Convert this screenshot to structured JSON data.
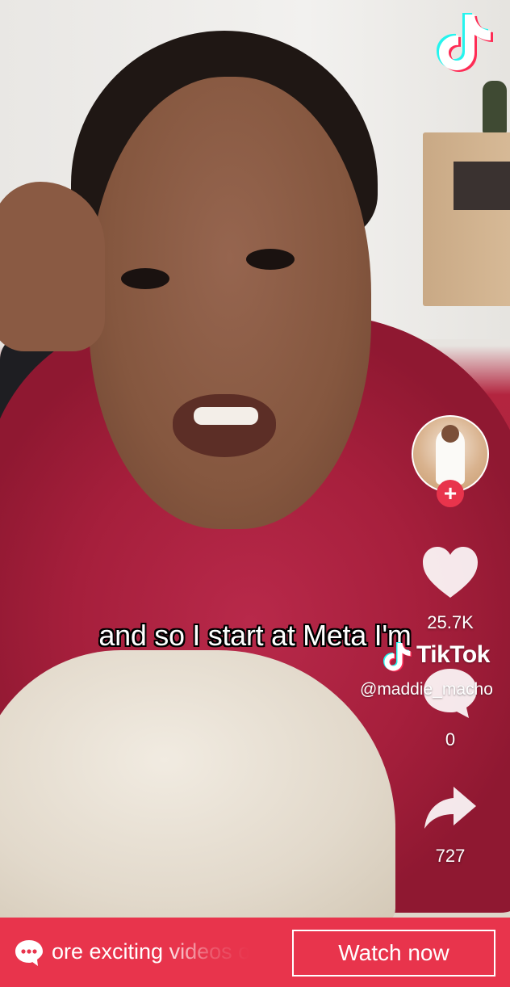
{
  "video": {
    "caption": "and so I start at Meta I'm"
  },
  "watermark": {
    "brand": "TikTok",
    "handle": "@maddie_macho"
  },
  "rail": {
    "likes": "25.7K",
    "comments": "0",
    "shares": "727",
    "follow_symbol": "+"
  },
  "bottom_bar": {
    "marquee_text": "ore exciting videos o",
    "watch_label": "Watch now"
  },
  "colors": {
    "accent": "#e8344c",
    "tiktok_cyan": "#25f4ee",
    "tiktok_red": "#fe2c55"
  },
  "icons": [
    "tiktok-logo-icon",
    "heart-icon",
    "comment-icon",
    "share-icon",
    "chat-bubble-icon",
    "plus-icon"
  ]
}
